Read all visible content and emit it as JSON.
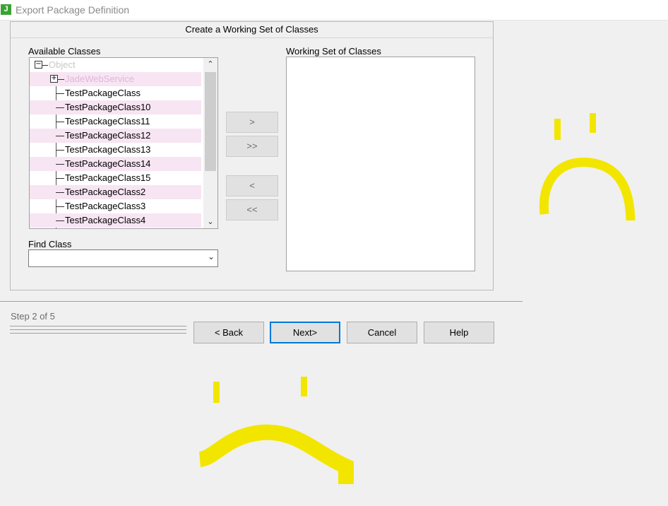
{
  "window": {
    "icon_letter": "J",
    "title": "Export Package Definition",
    "brand_color": "#3aa335"
  },
  "panel": {
    "header": "Create a Working Set of Classes",
    "available_label": "Available Classes",
    "working_label": "Working Set of Classes",
    "find_label": "Find Class",
    "find_value": ""
  },
  "tree": {
    "root": {
      "label": "Object",
      "expander": "collapse"
    },
    "child": {
      "label": "JadeWebService",
      "expander": "expand"
    },
    "items": [
      "TestPackageClass",
      "TestPackageClass10",
      "TestPackageClass11",
      "TestPackageClass12",
      "TestPackageClass13",
      "TestPackageClass14",
      "TestPackageClass15",
      "TestPackageClass2",
      "TestPackageClass3",
      "TestPackageClass4"
    ]
  },
  "transfer_buttons": {
    "add": ">",
    "add_all": ">>",
    "remove": "<",
    "remove_all": "<<"
  },
  "footer": {
    "step": "Step 2 of 5",
    "back": "< Back",
    "next": "Next>",
    "cancel": "Cancel",
    "help": "Help"
  },
  "annotation_color": "#f2e600"
}
